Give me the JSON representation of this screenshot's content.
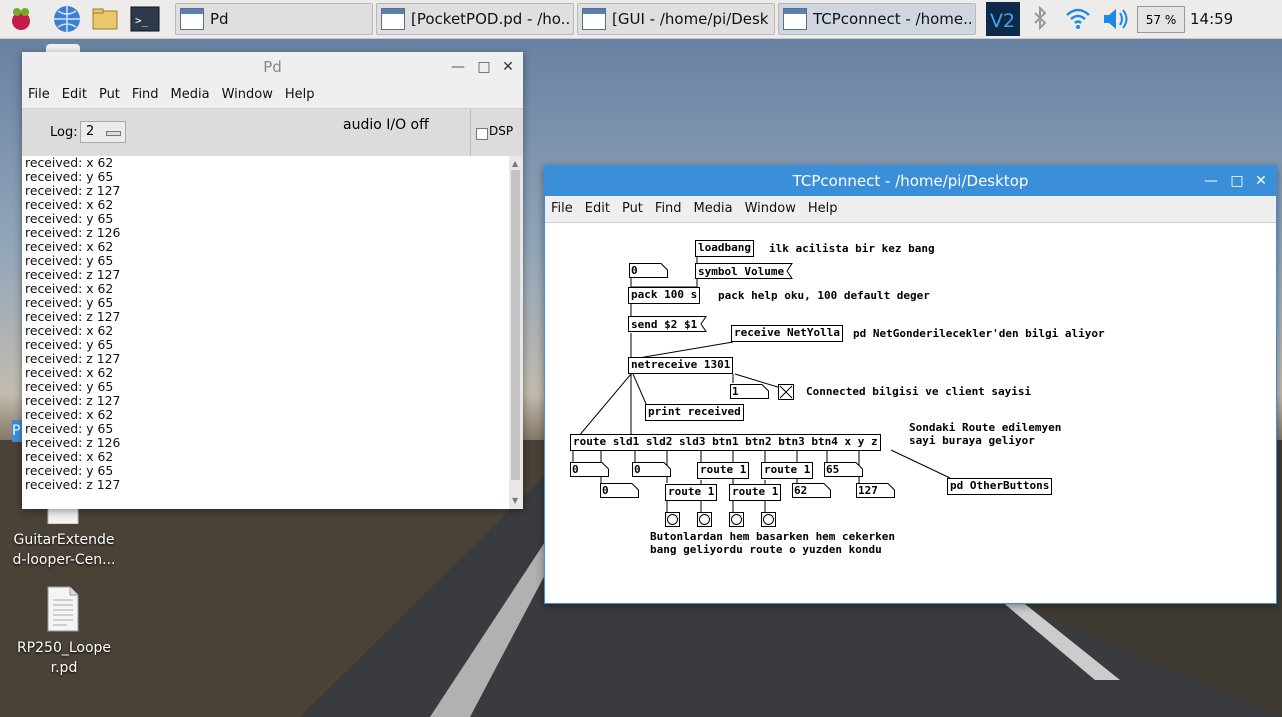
{
  "taskbar": {
    "tasks": [
      {
        "label": "Pd"
      },
      {
        "label": "[PocketPOD.pd  - /ho..."
      },
      {
        "label": "[GUI  - /home/pi/Desk..."
      },
      {
        "label": "TCPconnect  - /home..."
      }
    ],
    "volume_percent": "57 %",
    "clock": "14:59"
  },
  "desktop": {
    "icons": [
      {
        "label_line1": "GuitarExtende",
        "label_line2": "d-looper-Cen..."
      },
      {
        "label_line1": "RP250_Loope",
        "label_line2": "r.pd"
      }
    ]
  },
  "pd_window": {
    "title": "Pd",
    "menu": [
      "File",
      "Edit",
      "Put",
      "Find",
      "Media",
      "Window",
      "Help"
    ],
    "log_label": "Log:",
    "log_value": "2",
    "audio_status": "audio I/O off",
    "dsp_label": "DSP",
    "console_lines": [
      "received: x 62",
      "received: y 65",
      "received: z 127",
      "received: x 62",
      "received: y 65",
      "received: z 126",
      "received: x 62",
      "received: y 65",
      "received: z 127",
      "received: x 62",
      "received: y 65",
      "received: z 127",
      "received: x 62",
      "received: y 65",
      "received: z 127",
      "received: x 62",
      "received: y 65",
      "received: z 127",
      "received: x 62",
      "received: y 65",
      "received: z 126",
      "received: x 62",
      "received: y 65",
      "received: z 127"
    ]
  },
  "tcp_window": {
    "title": "TCPconnect  - /home/pi/Desktop",
    "menu": [
      "File",
      "Edit",
      "Put",
      "Find",
      "Media",
      "Window",
      "Help"
    ],
    "objects": {
      "loadbang": "loadbang",
      "symbol": "symbol Volume",
      "pack": "pack 100 s",
      "send": "send $2 $1",
      "receive": "receive NetYolla",
      "netreceive": "netreceive 1301",
      "print": "print received",
      "route_main": "route sld1 sld2 sld3 btn1 btn2 btn3 btn4 x y z",
      "route1a": "route 1",
      "route1b": "route 1",
      "route1c": "route 1",
      "route1d": "route 1",
      "pd_other": "pd OtherButtons"
    },
    "numbers": {
      "n_top": "0",
      "n_conn": "1",
      "n_r1": "0",
      "n_r2": "0",
      "n_r3": "0",
      "n_65": "65",
      "n_62": "62",
      "n_127": "127"
    },
    "comments": {
      "c_loadbang": "ilk acilista bir kez bang",
      "c_pack": "pack help oku, 100 default deger",
      "c_receive": "pd NetGonderilecekler'den bilgi aliyor",
      "c_connected": "Connected bilgisi ve client sayisi",
      "c_sondaki1": "Sondaki Route edilemyen",
      "c_sondaki2": "sayi buraya geliyor",
      "c_buton1": "Butonlardan hem basarken hem cekerken",
      "c_buton2": "bang geliyordu route o yuzden kondu"
    }
  }
}
